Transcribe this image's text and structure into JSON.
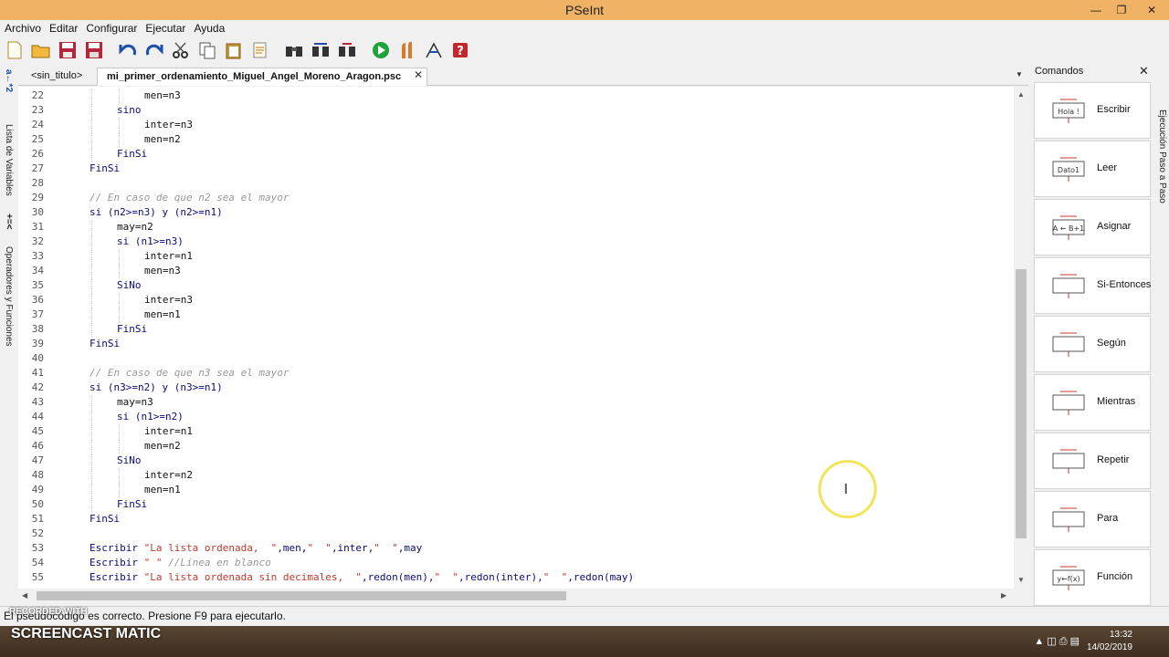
{
  "window": {
    "title": "PSeInt",
    "controls": [
      "minimize-icon",
      "restore-icon",
      "close-icon"
    ]
  },
  "menu": [
    "Archivo",
    "Editar",
    "Configurar",
    "Ejecutar",
    "Ayuda"
  ],
  "toolbar": {
    "icons": [
      "new-file-icon",
      "open-folder-icon",
      "save-icon",
      "save-as-icon",
      "undo-icon",
      "redo-icon",
      "cut-icon",
      "copy-icon",
      "paste-icon",
      "edit-icon",
      "binoculars-icon",
      "find-next-icon",
      "replace-icon",
      "run-icon",
      "step-icon",
      "debug-icon",
      "help-icon"
    ]
  },
  "left_panel": {
    "variables_label": "Lista de Variables",
    "operators_label": "Operadores y Funciones",
    "var_icon_text": "a←*2",
    "ops_icon_text": "+=<"
  },
  "tabs": [
    {
      "label": "<sin_titulo>",
      "active": false
    },
    {
      "label": "mi_primer_ordenamiento_Miguel_Angel_Moreno_Aragon.psc",
      "active": true
    }
  ],
  "editor": {
    "lines": [
      {
        "num": "22",
        "indent": 2,
        "text": "men=n3",
        "type": "code"
      },
      {
        "num": "23",
        "indent": 1,
        "text": "sino",
        "type": "kw"
      },
      {
        "num": "24",
        "indent": 2,
        "text": "inter=n3",
        "type": "code"
      },
      {
        "num": "25",
        "indent": 2,
        "text": "men=n2",
        "type": "code"
      },
      {
        "num": "26",
        "indent": 1,
        "text": "FinSi",
        "type": "kw"
      },
      {
        "num": "27",
        "indent": 0,
        "text": "FinSi",
        "type": "kw"
      },
      {
        "num": "28",
        "indent": 0,
        "text": "",
        "type": "code"
      },
      {
        "num": "29",
        "indent": 0,
        "text": "// En caso de que n2 sea el mayor",
        "type": "cmt"
      },
      {
        "num": "30",
        "indent": 0,
        "text": "si (n2>=n3) y (n2>=n1)",
        "type": "kw"
      },
      {
        "num": "31",
        "indent": 1,
        "text": "may=n2",
        "type": "code"
      },
      {
        "num": "32",
        "indent": 1,
        "text": "si (n1>=n3)",
        "type": "kw"
      },
      {
        "num": "33",
        "indent": 2,
        "text": "inter=n1",
        "type": "code"
      },
      {
        "num": "34",
        "indent": 2,
        "text": "men=n3",
        "type": "code"
      },
      {
        "num": "35",
        "indent": 1,
        "text": "SiNo",
        "type": "kw"
      },
      {
        "num": "36",
        "indent": 2,
        "text": "inter=n3",
        "type": "code"
      },
      {
        "num": "37",
        "indent": 2,
        "text": "men=n1",
        "type": "code"
      },
      {
        "num": "38",
        "indent": 1,
        "text": "FinSi",
        "type": "kw"
      },
      {
        "num": "39",
        "indent": 0,
        "text": "FinSi",
        "type": "kw"
      },
      {
        "num": "40",
        "indent": 0,
        "text": "",
        "type": "code"
      },
      {
        "num": "41",
        "indent": 0,
        "text": "// En caso de que n3 sea el mayor",
        "type": "cmt"
      },
      {
        "num": "42",
        "indent": 0,
        "text": "si (n3>=n2) y (n3>=n1)",
        "type": "kw"
      },
      {
        "num": "43",
        "indent": 1,
        "text": "may=n3",
        "type": "code"
      },
      {
        "num": "44",
        "indent": 1,
        "text": "si (n1>=n2)",
        "type": "kw"
      },
      {
        "num": "45",
        "indent": 2,
        "text": "inter=n1",
        "type": "code"
      },
      {
        "num": "46",
        "indent": 2,
        "text": "men=n2",
        "type": "code"
      },
      {
        "num": "47",
        "indent": 1,
        "text": "SiNo",
        "type": "kw"
      },
      {
        "num": "48",
        "indent": 2,
        "text": "inter=n2",
        "type": "code"
      },
      {
        "num": "49",
        "indent": 2,
        "text": "men=n1",
        "type": "code"
      },
      {
        "num": "50",
        "indent": 1,
        "text": "FinSi",
        "type": "kw"
      },
      {
        "num": "51",
        "indent": 0,
        "text": "FinSi",
        "type": "kw"
      },
      {
        "num": "52",
        "indent": 0,
        "text": "",
        "type": "code"
      },
      {
        "num": "53",
        "indent": 0,
        "text": "Escribir \"La lista ordenada,  \",men,\"  \",inter,\"  \",may",
        "type": "kw"
      },
      {
        "num": "54",
        "indent": 0,
        "text": "Escribir \" \" //Linea en blanco",
        "type": "kw"
      },
      {
        "num": "55",
        "indent": 0,
        "text": "Escribir \"La lista ordenada sin decimales,  \",redon(men),\"  \",redon(inter),\"  \",redon(may)",
        "type": "kw"
      }
    ]
  },
  "commands": {
    "title": "Comandos",
    "items": [
      {
        "label": "Escribir",
        "icon": "write-icon",
        "icon_text": "Hola !"
      },
      {
        "label": "Leer",
        "icon": "read-icon",
        "icon_text": "Dato1"
      },
      {
        "label": "Asignar",
        "icon": "assign-icon",
        "icon_text": "A ← B+1"
      },
      {
        "label": "Si-Entonces",
        "icon": "if-then-icon",
        "icon_text": ""
      },
      {
        "label": "Según",
        "icon": "switch-icon",
        "icon_text": ""
      },
      {
        "label": "Mientras",
        "icon": "while-icon",
        "icon_text": ""
      },
      {
        "label": "Repetir",
        "icon": "repeat-icon",
        "icon_text": ""
      },
      {
        "label": "Para",
        "icon": "for-icon",
        "icon_text": ""
      },
      {
        "label": "Función",
        "icon": "function-icon",
        "icon_text": "y←f(x)"
      }
    ]
  },
  "right_panel": {
    "label": "Ejecución Paso a Paso"
  },
  "status": {
    "message": "El pseudocódigo es correcto. Presione F9 para ejecutarlo."
  },
  "watermark": {
    "recorded": "RECORDED WITH",
    "brand": "SCREENCAST  MATIC"
  },
  "taskbar": {
    "time": "13:32",
    "date": "14/02/2019"
  },
  "colors": {
    "titlebar": "#f0b264",
    "keyword": "#0a0a7a",
    "string": "#c0392b",
    "comment": "#999999",
    "cursor_ring": "#f4e45c"
  }
}
